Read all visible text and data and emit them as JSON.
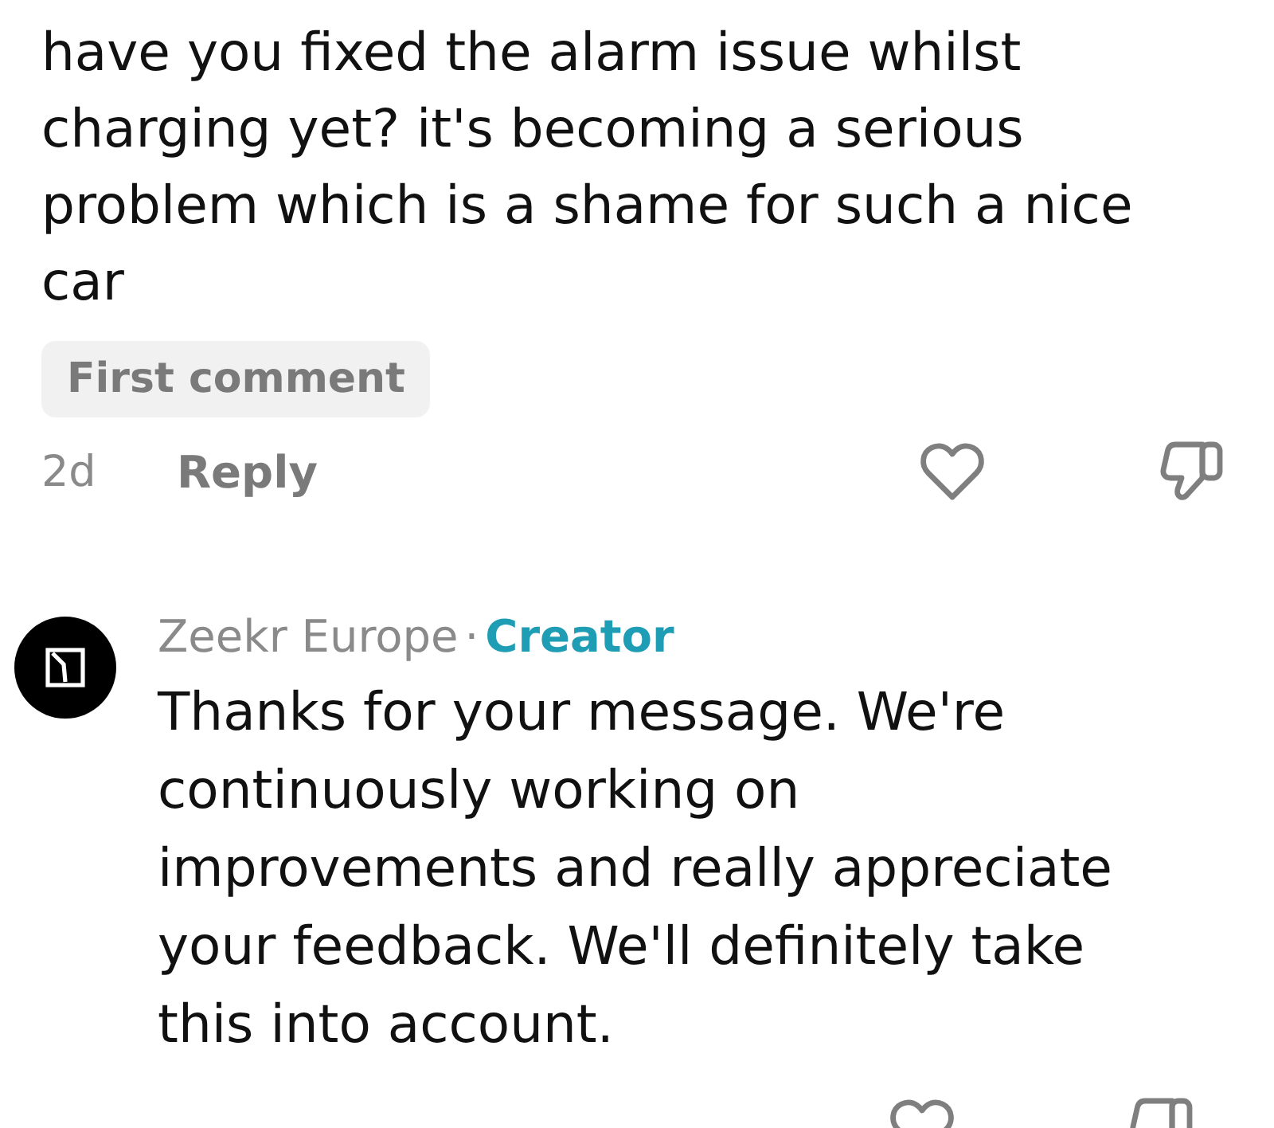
{
  "comment": {
    "text": "have you fixed the alarm issue whilst charging yet? it's becoming a serious problem which is a shame for such a nice car",
    "badge": "First comment",
    "time": "2d",
    "reply_label": "Reply",
    "liked": false,
    "disliked": false
  },
  "replies": [
    {
      "author": "Zeekr Europe",
      "separator": "·",
      "role": "Creator",
      "text": "Thanks for your message. We're continuously working on improvements and really appreciate your feedback. We'll definitely take this into account.",
      "liked": false,
      "disliked": false
    }
  ]
}
